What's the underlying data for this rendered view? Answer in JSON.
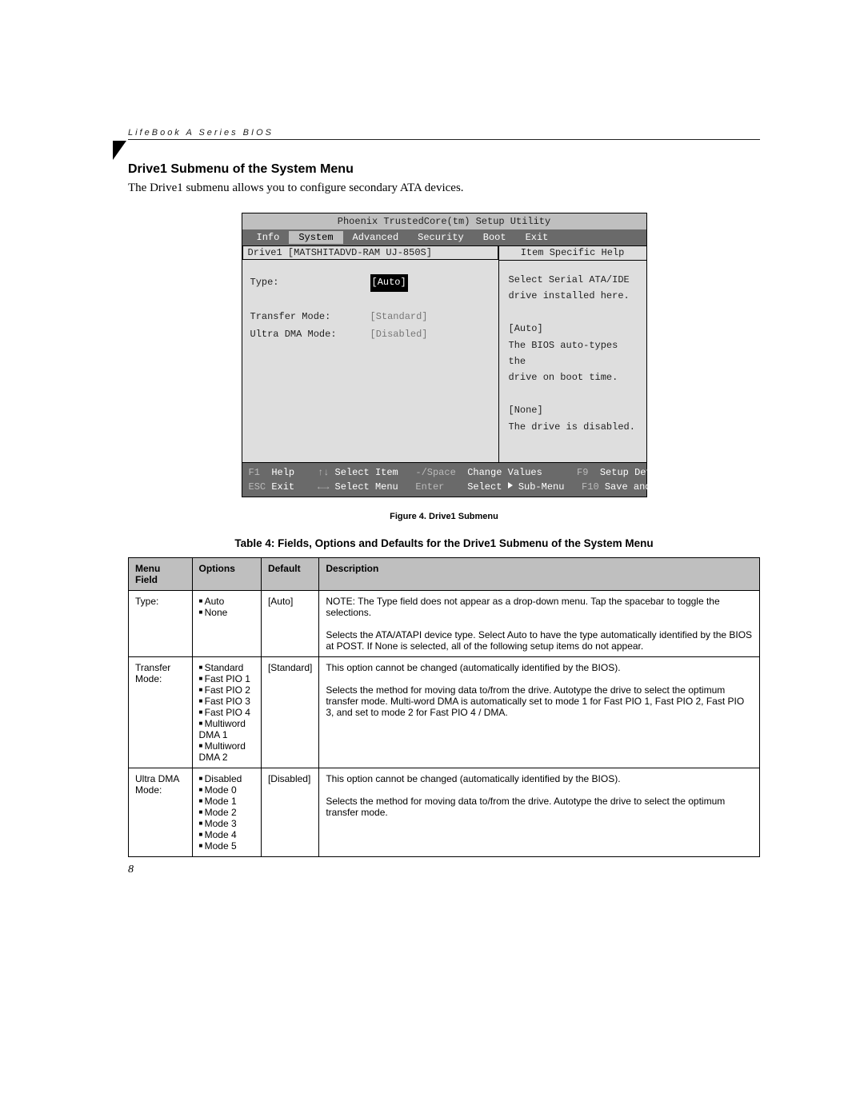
{
  "doc": {
    "running_header": "LifeBook A Series BIOS",
    "section_title": "Drive1 Submenu of the System Menu",
    "intro": "The Drive1 submenu allows you to configure secondary ATA devices.",
    "figure_caption": "Figure 4.  Drive1 Submenu",
    "table_title": "Table 4: Fields, Options and Defaults for the Drive1 Submenu of the System Menu",
    "page_number": "8"
  },
  "bios": {
    "title": "Phoenix TrustedCore(tm) Setup Utility",
    "tabs": [
      "Info",
      "System",
      "Advanced",
      "Security",
      "Boot",
      "Exit"
    ],
    "active_tab": "System",
    "drive_label": "Drive1 [MATSHITADVD-RAM UJ-850S]",
    "fields": [
      {
        "label": "Type:",
        "value": "[Auto]",
        "highlight": true
      },
      {
        "label": "Transfer Mode:",
        "value": "[Standard]",
        "dim": true
      },
      {
        "label": "Ultra DMA Mode:",
        "value": "[Disabled]",
        "dim": true
      }
    ],
    "help_title": "Item Specific Help",
    "help_body": [
      "Select Serial ATA/IDE",
      "drive installed here.",
      "",
      "[Auto]",
      "The BIOS auto-types the",
      "drive on boot time.",
      "",
      "[None]",
      "The drive is disabled."
    ],
    "footer": {
      "line1": {
        "f1": "F1",
        "help": "Help",
        "arrows1": "↑↓",
        "sel_item": "Select Item",
        "minus": "-/Space",
        "chg": "Change Values",
        "f9": "F9",
        "setup": "Setup Defaults"
      },
      "line2": {
        "esc": "ESC",
        "exit": "Exit",
        "arrows2": "←→",
        "sel_menu": "Select Menu",
        "enter": "Enter",
        "sub": "Select ▶ Sub-Menu",
        "f10": "F10",
        "save": "Save and Exit"
      }
    }
  },
  "table": {
    "headers": [
      "Menu Field",
      "Options",
      "Default",
      "Description"
    ],
    "rows": [
      {
        "field": "Type:",
        "options": [
          "Auto",
          "None"
        ],
        "default": "[Auto]",
        "description": "NOTE: The Type field does not appear as a drop-down menu. Tap the spacebar to toggle the selections.\n\nSelects the ATA/ATAPI device type. Select Auto to have the type automatically identified by the BIOS at POST. If None is selected, all of the following setup items do not appear."
      },
      {
        "field": "Transfer Mode:",
        "options": [
          "Standard",
          "Fast PIO 1",
          "Fast PIO 2",
          "Fast PIO 3",
          "Fast PIO 4",
          "Multiword DMA 1",
          "Multiword DMA 2"
        ],
        "default": "[Standard]",
        "description": "This option cannot be changed (automatically identified by the BIOS).\n\nSelects the method for moving data to/from the drive. Autotype the drive to select the optimum transfer mode.  Multi-word DMA is automatically set to mode 1 for Fast PIO 1, Fast PIO 2, Fast PIO 3, and set to mode 2 for Fast PIO 4 / DMA."
      },
      {
        "field": "Ultra DMA Mode:",
        "options": [
          "Disabled",
          "Mode 0",
          "Mode 1",
          "Mode 2",
          "Mode 3",
          "Mode 4",
          "Mode 5"
        ],
        "default": "[Disabled]",
        "description": "This option cannot be changed (automatically identified by the BIOS).\n\nSelects the method for moving data to/from the drive. Autotype the drive to select the optimum transfer mode."
      }
    ]
  }
}
